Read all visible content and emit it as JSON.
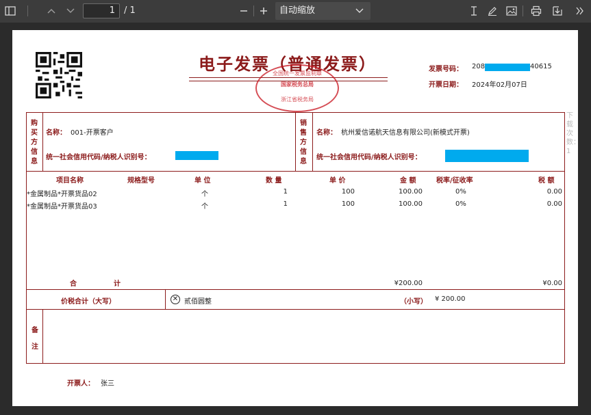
{
  "toolbar": {
    "page_current": "1",
    "page_total": "/ 1",
    "zoom_value": "自动缩放"
  },
  "invoice": {
    "title": "电子发票（普通发票）",
    "seal_top": "全国统一发票监制章",
    "seal_mid": "国家税务总局",
    "seal_bottom": "浙江省税务局",
    "number_label": "发票号码：",
    "number_prefix": "208",
    "number_suffix": "40615",
    "date_label": "开票日期：",
    "date_value": "2024年02月07日",
    "buyer_section": "购买方信息",
    "seller_section": "销售方信息",
    "name_label": "名称：",
    "buyer_name": "001-开票客户",
    "seller_name": "杭州爱信诺航天信息有限公司(新模式开票)",
    "credit_label": "统一社会信用代码/纳税人识别号：",
    "columns": {
      "item": "项目名称",
      "spec": "规格型号",
      "unit": "单 位",
      "qty": "数 量",
      "price": "单 价",
      "amount": "金 额",
      "rate": "税率/征收率",
      "tax": "税 额"
    },
    "rows": [
      {
        "item": "*金属制品*开票货品02",
        "unit": "个",
        "qty": "1",
        "price": "100",
        "amount": "100.00",
        "rate": "0%",
        "tax": "0.00"
      },
      {
        "item": "*金属制品*开票货品03",
        "unit": "个",
        "qty": "1",
        "price": "100",
        "amount": "100.00",
        "rate": "0%",
        "tax": "0.00"
      }
    ],
    "total_label_1": "合",
    "total_label_2": "计",
    "total_amount": "¥200.00",
    "total_tax": "¥0.00",
    "sum_caps_label": "价税合计（大写）",
    "sum_caps_value": "贰佰圆整",
    "sum_small_label": "（小写）",
    "sum_small_value": "¥ 200.00",
    "remarks_label_1": "备",
    "remarks_label_2": "注",
    "issuer_label": "开票人：",
    "issuer_value": "张三"
  },
  "side_note": "下载次数：1",
  "colors": {
    "invoice_red": "#8b1a1a",
    "redaction": "#00aaee",
    "toolbar": "#3c3c3c"
  }
}
